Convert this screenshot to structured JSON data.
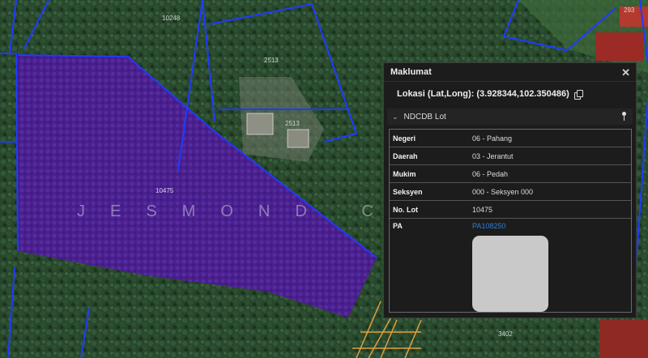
{
  "map": {
    "parcel_labels": [
      "10248",
      "2513",
      "2513",
      "293",
      "10475",
      "3402"
    ],
    "watermark": "JESMOND CHEONG"
  },
  "panel": {
    "title": "Maklumat",
    "location": "Lokasi (Lat,Long): (3.928344,102.350486)",
    "section": "NDCDB Lot",
    "fields": [
      {
        "label": "Negeri",
        "value": "06 - Pahang"
      },
      {
        "label": "Daerah",
        "value": "03 - Jerantut"
      },
      {
        "label": "Mukim",
        "value": "06 - Pedah"
      },
      {
        "label": "Seksyen",
        "value": "000 - Seksyen 000"
      },
      {
        "label": "No. Lot",
        "value": "10475"
      }
    ],
    "pa_label": "PA",
    "pa_value": "PA108250"
  },
  "colors": {
    "parcel_highlight": "#4a1a8f",
    "boundary_lines": "#1e3cff",
    "lot_lines": "#e0a040",
    "panel_bg": "#1c1c1c",
    "link": "#2f7fd6"
  }
}
